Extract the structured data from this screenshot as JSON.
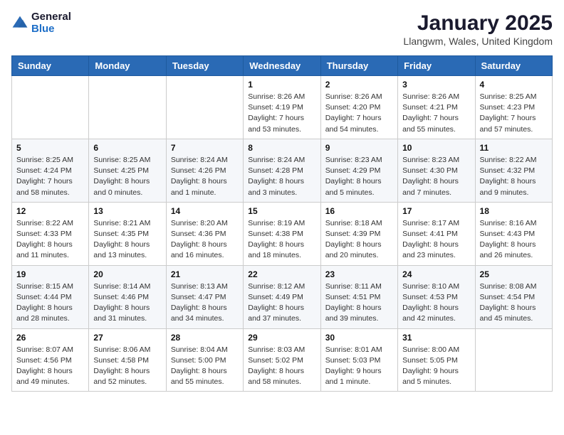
{
  "logo": {
    "general": "General",
    "blue": "Blue"
  },
  "header": {
    "month_year": "January 2025",
    "location": "Llangwm, Wales, United Kingdom"
  },
  "weekdays": [
    "Sunday",
    "Monday",
    "Tuesday",
    "Wednesday",
    "Thursday",
    "Friday",
    "Saturday"
  ],
  "weeks": [
    [
      {
        "day": "",
        "info": ""
      },
      {
        "day": "",
        "info": ""
      },
      {
        "day": "",
        "info": ""
      },
      {
        "day": "1",
        "info": "Sunrise: 8:26 AM\nSunset: 4:19 PM\nDaylight: 7 hours\nand 53 minutes."
      },
      {
        "day": "2",
        "info": "Sunrise: 8:26 AM\nSunset: 4:20 PM\nDaylight: 7 hours\nand 54 minutes."
      },
      {
        "day": "3",
        "info": "Sunrise: 8:26 AM\nSunset: 4:21 PM\nDaylight: 7 hours\nand 55 minutes."
      },
      {
        "day": "4",
        "info": "Sunrise: 8:25 AM\nSunset: 4:23 PM\nDaylight: 7 hours\nand 57 minutes."
      }
    ],
    [
      {
        "day": "5",
        "info": "Sunrise: 8:25 AM\nSunset: 4:24 PM\nDaylight: 7 hours\nand 58 minutes."
      },
      {
        "day": "6",
        "info": "Sunrise: 8:25 AM\nSunset: 4:25 PM\nDaylight: 8 hours\nand 0 minutes."
      },
      {
        "day": "7",
        "info": "Sunrise: 8:24 AM\nSunset: 4:26 PM\nDaylight: 8 hours\nand 1 minute."
      },
      {
        "day": "8",
        "info": "Sunrise: 8:24 AM\nSunset: 4:28 PM\nDaylight: 8 hours\nand 3 minutes."
      },
      {
        "day": "9",
        "info": "Sunrise: 8:23 AM\nSunset: 4:29 PM\nDaylight: 8 hours\nand 5 minutes."
      },
      {
        "day": "10",
        "info": "Sunrise: 8:23 AM\nSunset: 4:30 PM\nDaylight: 8 hours\nand 7 minutes."
      },
      {
        "day": "11",
        "info": "Sunrise: 8:22 AM\nSunset: 4:32 PM\nDaylight: 8 hours\nand 9 minutes."
      }
    ],
    [
      {
        "day": "12",
        "info": "Sunrise: 8:22 AM\nSunset: 4:33 PM\nDaylight: 8 hours\nand 11 minutes."
      },
      {
        "day": "13",
        "info": "Sunrise: 8:21 AM\nSunset: 4:35 PM\nDaylight: 8 hours\nand 13 minutes."
      },
      {
        "day": "14",
        "info": "Sunrise: 8:20 AM\nSunset: 4:36 PM\nDaylight: 8 hours\nand 16 minutes."
      },
      {
        "day": "15",
        "info": "Sunrise: 8:19 AM\nSunset: 4:38 PM\nDaylight: 8 hours\nand 18 minutes."
      },
      {
        "day": "16",
        "info": "Sunrise: 8:18 AM\nSunset: 4:39 PM\nDaylight: 8 hours\nand 20 minutes."
      },
      {
        "day": "17",
        "info": "Sunrise: 8:17 AM\nSunset: 4:41 PM\nDaylight: 8 hours\nand 23 minutes."
      },
      {
        "day": "18",
        "info": "Sunrise: 8:16 AM\nSunset: 4:43 PM\nDaylight: 8 hours\nand 26 minutes."
      }
    ],
    [
      {
        "day": "19",
        "info": "Sunrise: 8:15 AM\nSunset: 4:44 PM\nDaylight: 8 hours\nand 28 minutes."
      },
      {
        "day": "20",
        "info": "Sunrise: 8:14 AM\nSunset: 4:46 PM\nDaylight: 8 hours\nand 31 minutes."
      },
      {
        "day": "21",
        "info": "Sunrise: 8:13 AM\nSunset: 4:47 PM\nDaylight: 8 hours\nand 34 minutes."
      },
      {
        "day": "22",
        "info": "Sunrise: 8:12 AM\nSunset: 4:49 PM\nDaylight: 8 hours\nand 37 minutes."
      },
      {
        "day": "23",
        "info": "Sunrise: 8:11 AM\nSunset: 4:51 PM\nDaylight: 8 hours\nand 39 minutes."
      },
      {
        "day": "24",
        "info": "Sunrise: 8:10 AM\nSunset: 4:53 PM\nDaylight: 8 hours\nand 42 minutes."
      },
      {
        "day": "25",
        "info": "Sunrise: 8:08 AM\nSunset: 4:54 PM\nDaylight: 8 hours\nand 45 minutes."
      }
    ],
    [
      {
        "day": "26",
        "info": "Sunrise: 8:07 AM\nSunset: 4:56 PM\nDaylight: 8 hours\nand 49 minutes."
      },
      {
        "day": "27",
        "info": "Sunrise: 8:06 AM\nSunset: 4:58 PM\nDaylight: 8 hours\nand 52 minutes."
      },
      {
        "day": "28",
        "info": "Sunrise: 8:04 AM\nSunset: 5:00 PM\nDaylight: 8 hours\nand 55 minutes."
      },
      {
        "day": "29",
        "info": "Sunrise: 8:03 AM\nSunset: 5:02 PM\nDaylight: 8 hours\nand 58 minutes."
      },
      {
        "day": "30",
        "info": "Sunrise: 8:01 AM\nSunset: 5:03 PM\nDaylight: 9 hours\nand 1 minute."
      },
      {
        "day": "31",
        "info": "Sunrise: 8:00 AM\nSunset: 5:05 PM\nDaylight: 9 hours\nand 5 minutes."
      },
      {
        "day": "",
        "info": ""
      }
    ]
  ]
}
